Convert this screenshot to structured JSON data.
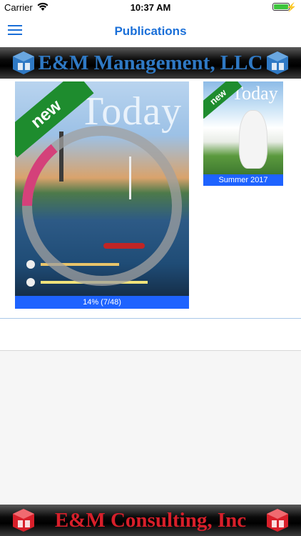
{
  "status_bar": {
    "carrier": "Carrier",
    "time": "10:37 AM"
  },
  "nav": {
    "title": "Publications"
  },
  "banner_top": {
    "text": "E&M Management, LLC"
  },
  "banner_bottom": {
    "text": "E&M Consulting, Inc"
  },
  "publications": [
    {
      "badge": "new",
      "masthead": "Today",
      "caption": "14% (7/48)",
      "download_progress": 0.14
    },
    {
      "badge": "new",
      "masthead": "Today",
      "caption": "Summer 2017"
    }
  ],
  "colors": {
    "accent": "#1a6fd8",
    "caption_bg": "#1e63ff",
    "ribbon": "#1e8c2e",
    "banner_top_text": "#2f79c4",
    "banner_bottom_text": "#d81f2a"
  }
}
